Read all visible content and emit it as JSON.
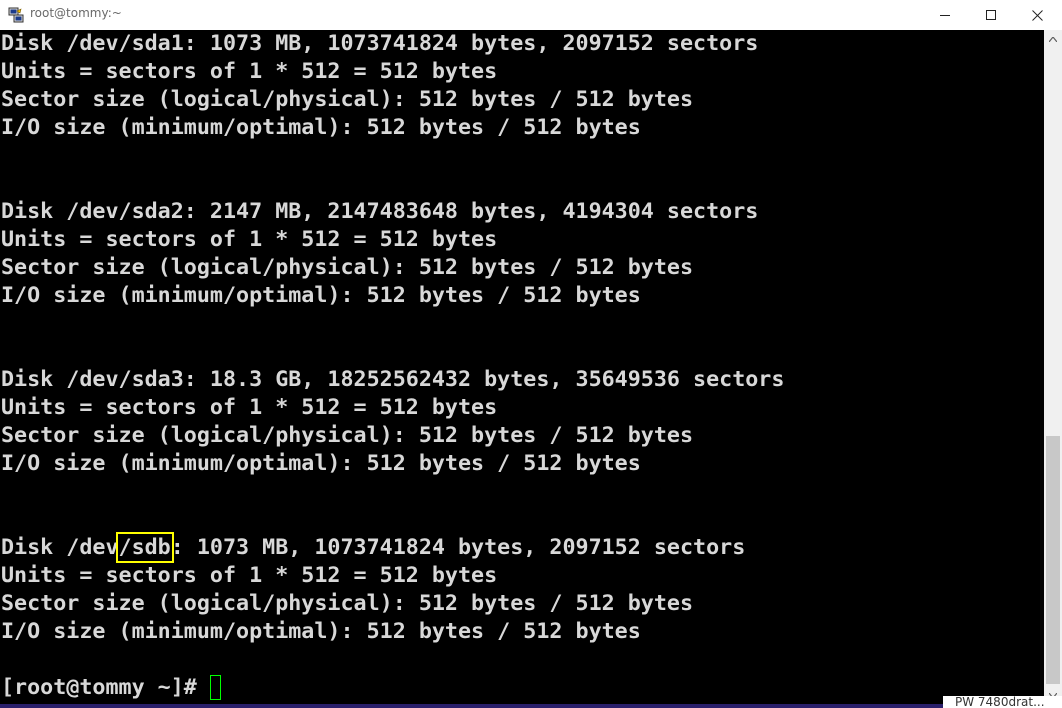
{
  "window": {
    "title": "root@tommy:~",
    "app_icon": "putty-icon",
    "controls": {
      "minimize_icon": "minimize-icon",
      "maximize_icon": "maximize-icon",
      "close_icon": "close-icon"
    }
  },
  "terminal": {
    "background": "#000000",
    "foreground": "#d8d8d8",
    "cursor_color": "#00ff00",
    "highlight_color": "#ffff00",
    "lines": [
      "Disk /dev/sda1: 1073 MB, 1073741824 bytes, 2097152 sectors",
      "Units = sectors of 1 * 512 = 512 bytes",
      "Sector size (logical/physical): 512 bytes / 512 bytes",
      "I/O size (minimum/optimal): 512 bytes / 512 bytes",
      "",
      "",
      "Disk /dev/sda2: 2147 MB, 2147483648 bytes, 4194304 sectors",
      "Units = sectors of 1 * 512 = 512 bytes",
      "Sector size (logical/physical): 512 bytes / 512 bytes",
      "I/O size (minimum/optimal): 512 bytes / 512 bytes",
      "",
      "",
      "Disk /dev/sda3: 18.3 GB, 18252562432 bytes, 35649536 sectors",
      "Units = sectors of 1 * 512 = 512 bytes",
      "Sector size (logical/physical): 512 bytes / 512 bytes",
      "I/O size (minimum/optimal): 512 bytes / 512 bytes",
      "",
      "",
      "Disk /dev/sdb: 1073 MB, 1073741824 bytes, 2097152 sectors",
      "Units = sectors of 1 * 512 = 512 bytes",
      "Sector size (logical/physical): 512 bytes / 512 bytes",
      "I/O size (minimum/optimal): 512 bytes / 512 bytes"
    ],
    "highlighted": {
      "line_index": 18,
      "text": "/sdb"
    },
    "prompt": "[root@tommy ~]# "
  },
  "scrollbar": {
    "up_icon": "scroll-up-arrow-icon",
    "down_icon": "scroll-down-arrow-icon"
  },
  "background_window": {
    "text": "PW 7480drat..."
  }
}
